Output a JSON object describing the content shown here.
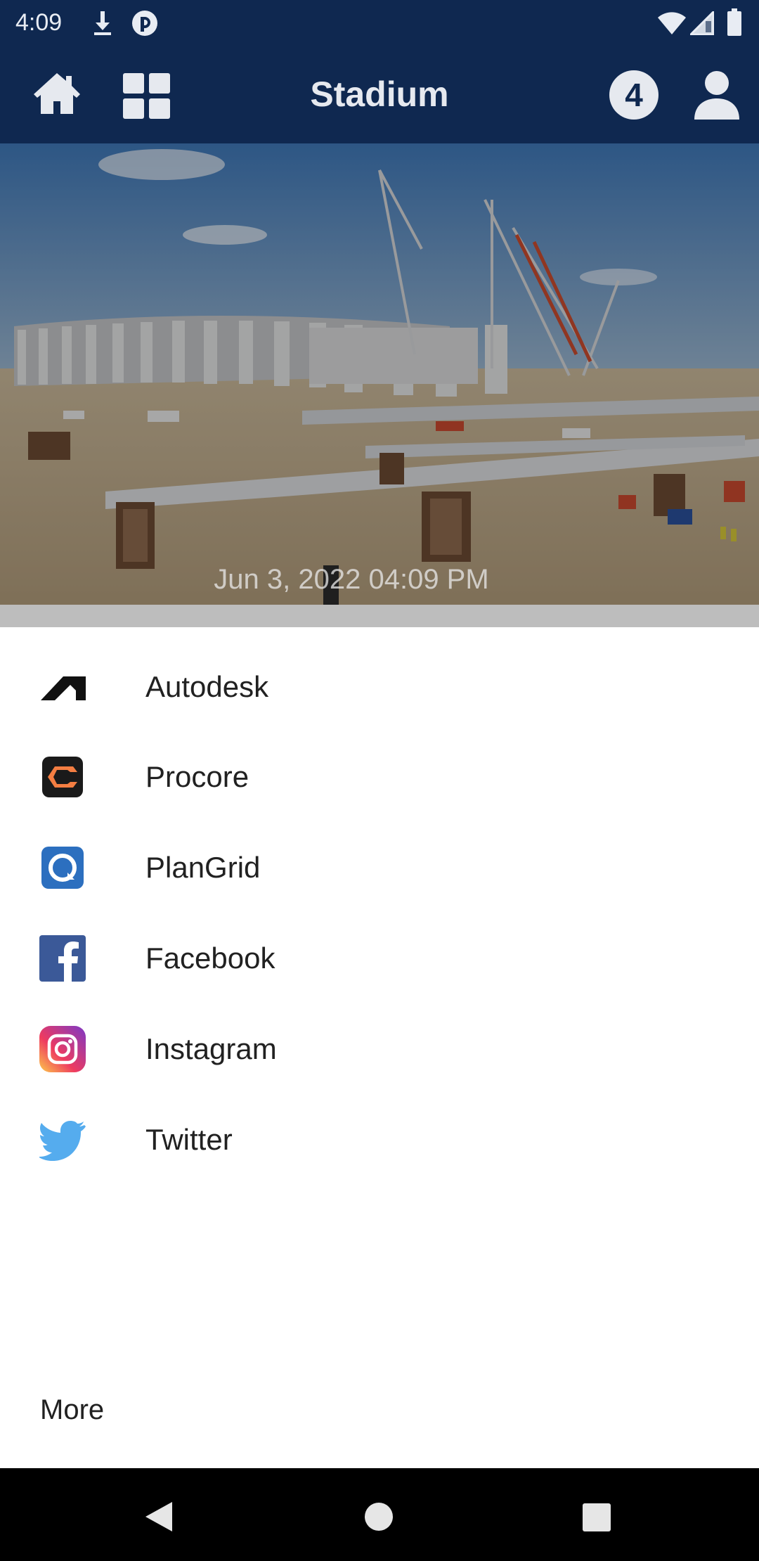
{
  "status_bar": {
    "time": "4:09",
    "left_icons": [
      "download-icon",
      "notification-app-icon"
    ],
    "right_icons": [
      "wifi-icon",
      "cellular-signal-icon",
      "battery-icon"
    ]
  },
  "app_bar": {
    "title": "Stadium",
    "badge_count": "4",
    "icons": [
      "home-icon",
      "grid-icon",
      "account-icon"
    ]
  },
  "camera": {
    "timestamp": "Jun 3, 2022 04:09 PM"
  },
  "share_sheet": {
    "items": [
      {
        "label": "Autodesk",
        "icon": "autodesk-icon"
      },
      {
        "label": "Procore",
        "icon": "procore-icon"
      },
      {
        "label": "PlanGrid",
        "icon": "plangrid-icon"
      },
      {
        "label": "Facebook",
        "icon": "facebook-icon"
      },
      {
        "label": "Instagram",
        "icon": "instagram-icon"
      },
      {
        "label": "Twitter",
        "icon": "twitter-icon"
      }
    ],
    "more_label": "More"
  },
  "nav_bar": {
    "icons": [
      "back-icon",
      "home-circle-icon",
      "recents-icon"
    ]
  },
  "colors": {
    "app_bar": "#0f2850",
    "sheet_background": "#ffffff",
    "facebook": "#3b5998",
    "twitter": "#55acee",
    "plangrid": "#2c6fbf"
  }
}
